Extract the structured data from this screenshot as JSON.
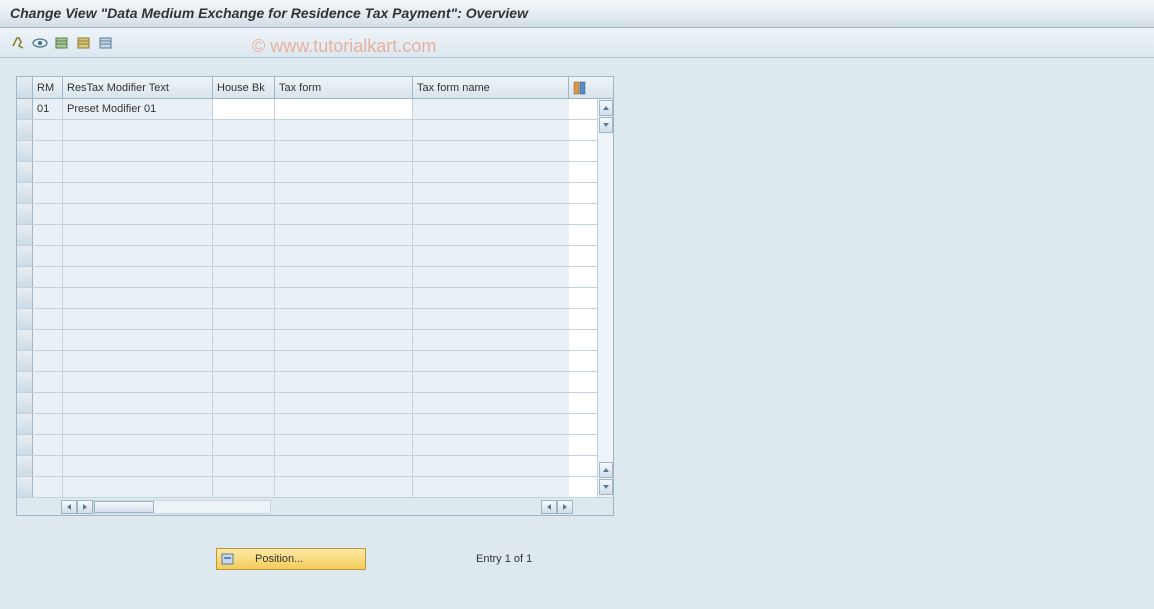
{
  "title": "Change View \"Data Medium Exchange for Residence Tax Payment\": Overview",
  "watermark": "© www.tutorialkart.com",
  "toolbar": {
    "icons": [
      "toggle",
      "glasses",
      "table1",
      "table2",
      "table3"
    ]
  },
  "table": {
    "headers": {
      "rm": "RM",
      "mod_text": "ResTax Modifier Text",
      "house_bk": "House Bk",
      "tax_form": "Tax form",
      "tax_form_name": "Tax form name"
    },
    "rows": [
      {
        "rm": "01",
        "mod_text": "Preset Modifier 01",
        "house_bk": "",
        "tax_form": "",
        "tax_form_name": ""
      }
    ],
    "empty_rows": 18
  },
  "footer": {
    "position_btn": "Position...",
    "entry_text": "Entry 1 of 1"
  }
}
